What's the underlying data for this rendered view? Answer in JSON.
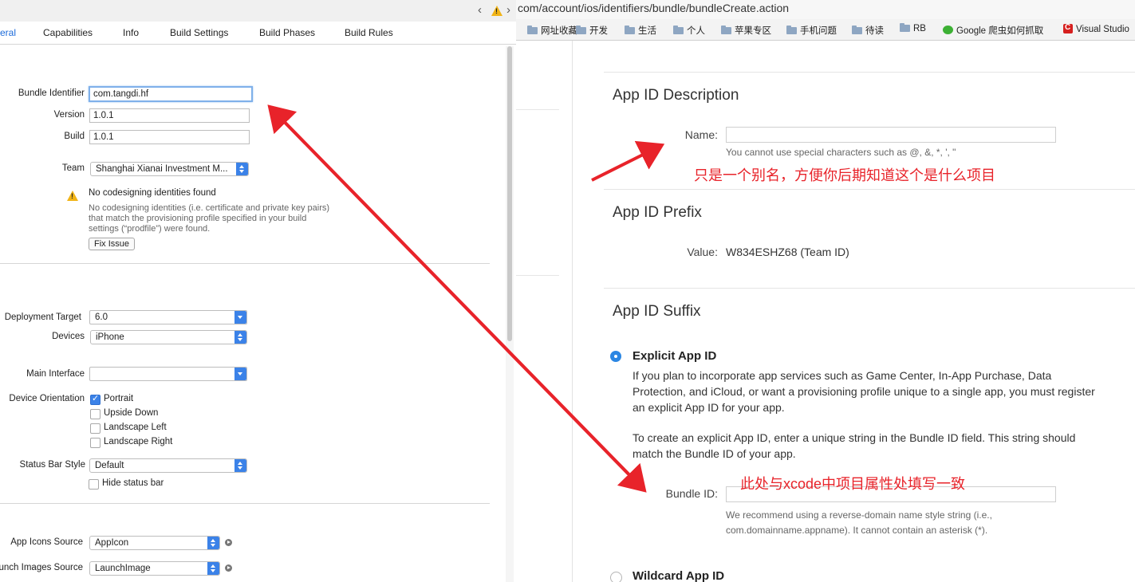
{
  "xcode": {
    "tabs": [
      "eral",
      "Capabilities",
      "Info",
      "Build Settings",
      "Build Phases",
      "Build Rules"
    ],
    "identity": {
      "bundle_identifier_label": "Bundle Identifier",
      "bundle_identifier_value": "com.tangdi.hf",
      "version_label": "Version",
      "version_value": "1.0.1",
      "build_label": "Build",
      "build_value": "1.0.1",
      "team_label": "Team",
      "team_value": "Shanghai Xianai Investment M..."
    },
    "warning": {
      "title": "No codesigning identities found",
      "detail_lines": [
        "No codesigning identities (i.e. certificate and private key pairs)",
        "that match the provisioning profile specified in your build",
        "settings (“prodfile”) were found."
      ],
      "fix_button": "Fix Issue"
    },
    "deployment": {
      "target_label": "Deployment Target",
      "target_value": "6.0",
      "devices_label": "Devices",
      "devices_value": "iPhone",
      "main_interface_label": "Main Interface",
      "main_interface_value": "",
      "orientation_label": "Device Orientation",
      "orientations": [
        {
          "label": "Portrait",
          "checked": true
        },
        {
          "label": "Upside Down",
          "checked": false
        },
        {
          "label": "Landscape Left",
          "checked": false
        },
        {
          "label": "Landscape Right",
          "checked": false
        }
      ],
      "status_bar_label": "Status Bar Style",
      "status_bar_value": "Default",
      "hide_status_bar": "Hide status bar"
    },
    "app_icons": {
      "icons_label": "App Icons Source",
      "icons_value": "AppIcon",
      "launch_label": "unch Images Source",
      "launch_value": "LaunchImage"
    }
  },
  "browser": {
    "url": "com/account/ios/identifiers/bundle/bundleCreate.action",
    "bookmarks": [
      "网址收藏",
      "开发",
      "生活",
      "个人",
      "苹果专区",
      "手机问题",
      "待读",
      "RB",
      "Google 爬虫如何抓取",
      "Visual Studio"
    ],
    "description": {
      "title": "App ID Description",
      "name_label": "Name:",
      "name_value": "",
      "name_hint": "You cannot use special characters such as @, &, *, ', \""
    },
    "prefix": {
      "title": "App ID Prefix",
      "value_label": "Value:",
      "value": "W834ESHZ68 (Team ID)"
    },
    "suffix": {
      "title": "App ID Suffix",
      "explicit_label": "Explicit App ID",
      "explicit_para1": "If you plan to incorporate app services such as Game Center, In-App Purchase, Data Protection, and iCloud, or want a provisioning profile unique to a single app, you must register an explicit App ID for your app.",
      "explicit_para2": "To create an explicit App ID, enter a unique string in the Bundle ID field. This string should match the Bundle ID of your app.",
      "bundle_id_label": "Bundle ID:",
      "bundle_id_value": "",
      "bundle_hint_1": "We recommend using a reverse-domain name style string (i.e.,",
      "bundle_hint_2": "com.domainname.appname). It cannot contain an asterisk (*).",
      "wildcard_label": "Wildcard App ID"
    }
  },
  "annotations": {
    "name_note": "只是一个别名，方便你后期知道这个是什么项目",
    "bundle_note": "此处与xcode中项目属性处填写一致"
  },
  "colors": {
    "accent": "#3b82e8",
    "annotation": "#e8232a",
    "warning": "#f1b417"
  }
}
